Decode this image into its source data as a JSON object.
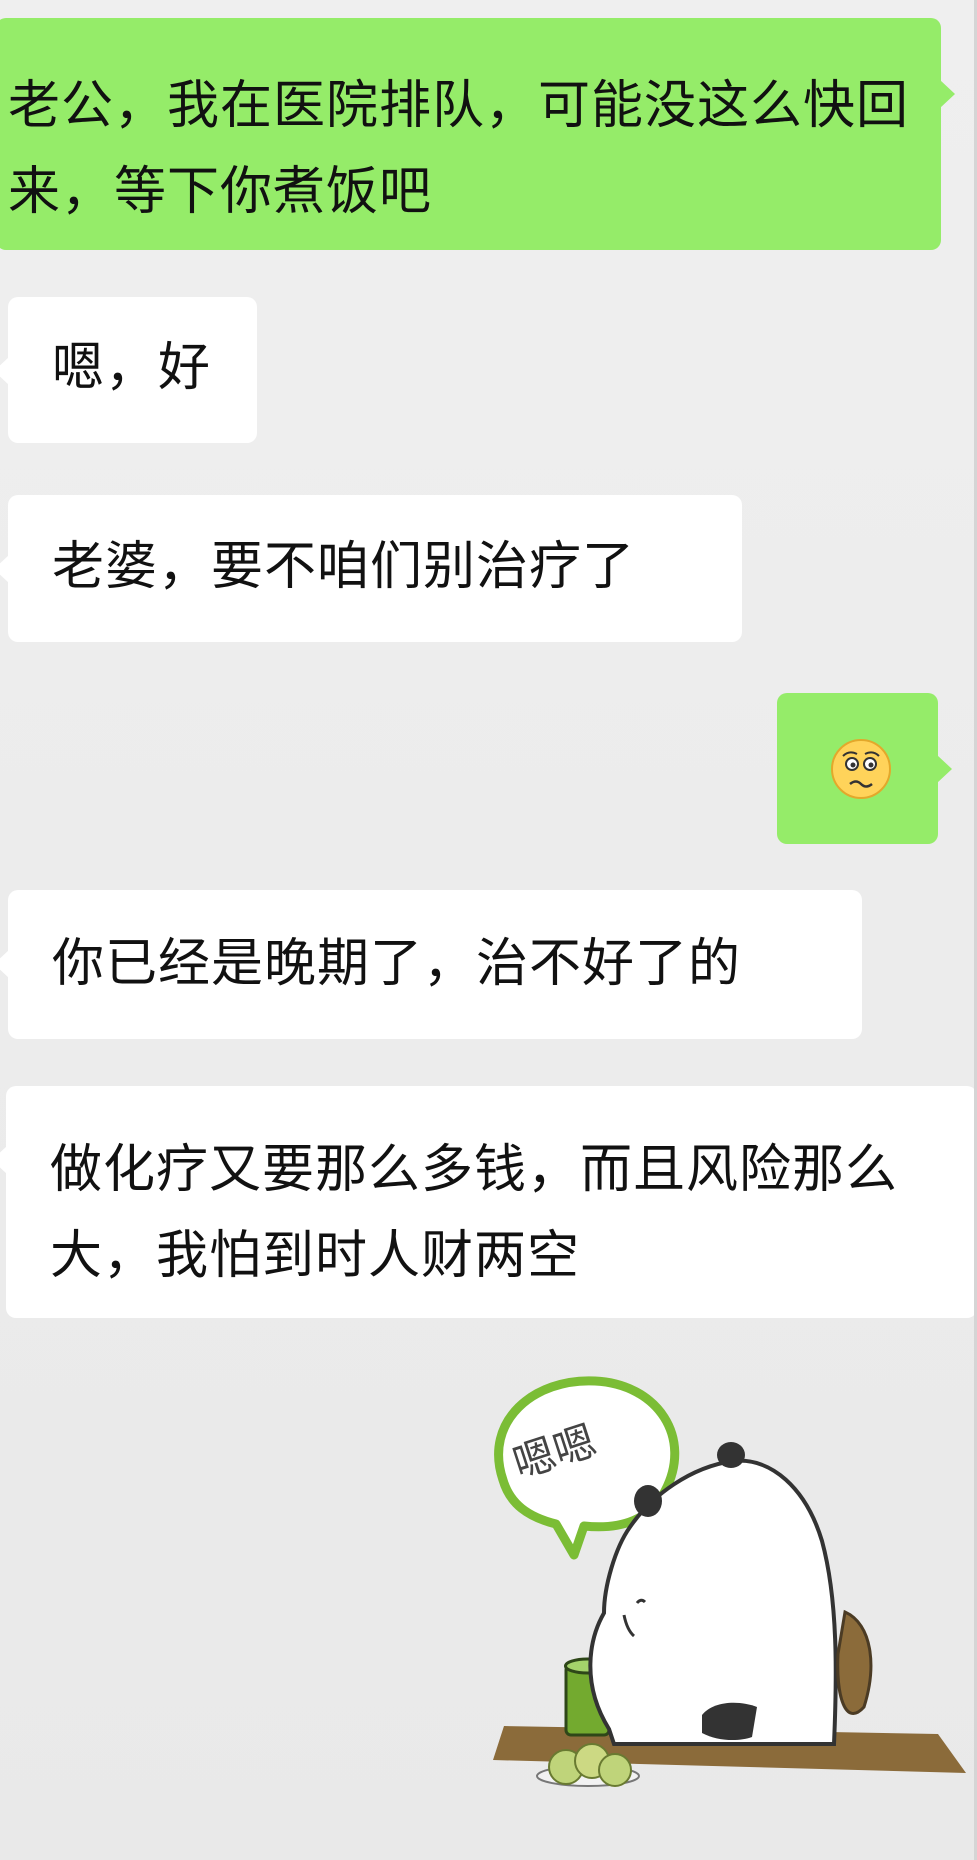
{
  "messages": [
    {
      "side": "sent",
      "text": "老公，我在医院排队，可能没这么快回来，等下你煮饭吧"
    },
    {
      "side": "received",
      "text": "嗯，好"
    },
    {
      "side": "received",
      "text": "老婆，要不咱们别治疗了"
    },
    {
      "side": "sent",
      "emoji": "worried-face-emoji"
    },
    {
      "side": "received",
      "text": "你已经是晚期了，治不好了的"
    },
    {
      "side": "received",
      "text": "做化疗又要那么多钱，而且风险那么大，我怕到时人财两空"
    }
  ],
  "sticker": {
    "name": "panda-sticker",
    "speech_text": "嗯嗯"
  },
  "colors": {
    "background": "#ececec",
    "sent_bubble": "#95ec69",
    "received_bubble": "#ffffff",
    "sticker_outline": "#7bbd35",
    "table": "#8b6b3a"
  }
}
